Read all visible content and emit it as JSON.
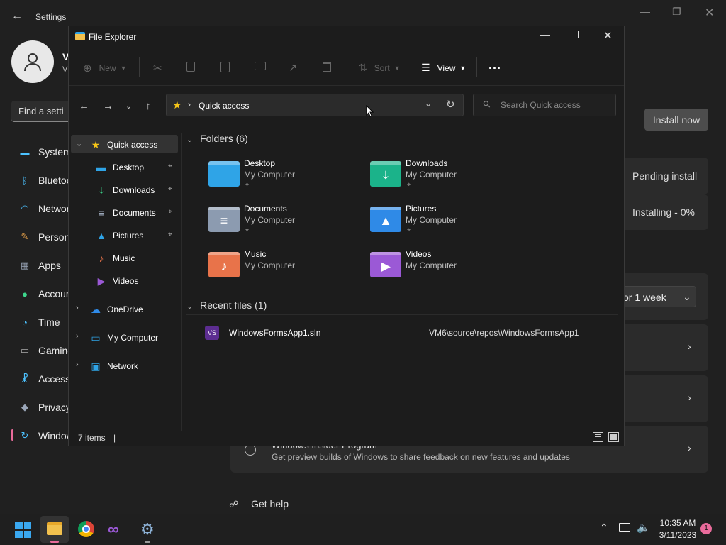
{
  "settings": {
    "title": "Settings",
    "user_initial_1": "V",
    "user_initial_2": "V",
    "find_placeholder": "Find a setti",
    "nav": [
      {
        "label": "System",
        "icon": "monitor-icon",
        "color": "#4cc2ff"
      },
      {
        "label": "Bluetooth",
        "icon": "bluetooth-icon",
        "color": "#4cc2ff"
      },
      {
        "label": "Network",
        "icon": "wifi-icon",
        "color": "#4cc2ff"
      },
      {
        "label": "Personalization",
        "icon": "brush-icon",
        "color": "#e8a24a"
      },
      {
        "label": "Apps",
        "icon": "apps-icon",
        "color": "#9aa6b8"
      },
      {
        "label": "Accounts",
        "icon": "person-icon",
        "color": "#3dd68c"
      },
      {
        "label": "Time",
        "icon": "clock-icon",
        "color": "#4cc2ff"
      },
      {
        "label": "Gaming",
        "icon": "gamepad-icon",
        "color": "#aaaaaa"
      },
      {
        "label": "Accessibility",
        "icon": "accessibility-icon",
        "color": "#4cc2ff"
      },
      {
        "label": "Privacy",
        "icon": "shield-icon",
        "color": "#9aa6b8"
      },
      {
        "label": "Windows Update",
        "icon": "update-icon",
        "color": "#4cc2ff"
      }
    ],
    "install_now": "Install now",
    "pending_install": "Pending install",
    "installing": "Installing - 0%",
    "pause_value": "or 1 week",
    "insider_title": "Windows Insider Program",
    "insider_desc": "Get preview builds of Windows to share feedback on new features and updates",
    "get_help": "Get help"
  },
  "explorer": {
    "title": "File Explorer",
    "toolbar": {
      "new": "New",
      "sort": "Sort",
      "view": "View",
      "more": "..."
    },
    "address": "Quick access",
    "search_placeholder": "Search Quick access",
    "tree": [
      {
        "label": "Quick access",
        "icon": "star-icon",
        "color": "#f5c518",
        "pinned": false
      },
      {
        "label": "Desktop",
        "icon": "desktop-icon",
        "color": "#2fa4e7",
        "pinned": true
      },
      {
        "label": "Downloads",
        "icon": "download-icon",
        "color": "#3dd68c",
        "pinned": true
      },
      {
        "label": "Documents",
        "icon": "document-icon",
        "color": "#9aa6b8",
        "pinned": true
      },
      {
        "label": "Pictures",
        "icon": "picture-icon",
        "color": "#2fa4e7",
        "pinned": true
      },
      {
        "label": "Music",
        "icon": "music-icon",
        "color": "#e8734a",
        "pinned": false
      },
      {
        "label": "Videos",
        "icon": "video-icon",
        "color": "#9b59d6",
        "pinned": false
      },
      {
        "label": "OneDrive",
        "icon": "cloud-icon",
        "color": "#2f8ae7",
        "pinned": false
      },
      {
        "label": "My Computer",
        "icon": "computer-icon",
        "color": "#2fa4e7",
        "pinned": false
      },
      {
        "label": "Network",
        "icon": "network-icon",
        "color": "#2fa4e7",
        "pinned": false
      }
    ],
    "folders_header": "Folders (6)",
    "folders": [
      {
        "name": "Desktop",
        "location": "My Computer",
        "pinned": true,
        "icon": "desktop-folder-icon",
        "color": "#2fa4e7"
      },
      {
        "name": "Downloads",
        "location": "My Computer",
        "pinned": true,
        "icon": "downloads-folder-icon",
        "color": "#1bb38a"
      },
      {
        "name": "Documents",
        "location": "My Computer",
        "pinned": true,
        "icon": "documents-folder-icon",
        "color": "#8c9bb0"
      },
      {
        "name": "Pictures",
        "location": "My Computer",
        "pinned": true,
        "icon": "pictures-folder-icon",
        "color": "#2f8ae7"
      },
      {
        "name": "Music",
        "location": "My Computer",
        "pinned": false,
        "icon": "music-folder-icon",
        "color": "#e8734a"
      },
      {
        "name": "Videos",
        "location": "My Computer",
        "pinned": false,
        "icon": "videos-folder-icon",
        "color": "#9b59d6"
      }
    ],
    "recent_header": "Recent files (1)",
    "recent": [
      {
        "name": "WindowsFormsApp1.sln",
        "path": "VM6\\source\\repos\\WindowsFormsApp1",
        "icon": "visual-studio-solution-icon"
      }
    ],
    "status": "7 items",
    "status_cursor": "|"
  },
  "taskbar": {
    "apps": [
      "windows-start-icon",
      "file-explorer-icon",
      "chrome-icon",
      "visual-studio-icon",
      "settings-gear-icon"
    ],
    "time": "10:35 AM",
    "date": "3/11/2023",
    "notification_count": "1"
  }
}
